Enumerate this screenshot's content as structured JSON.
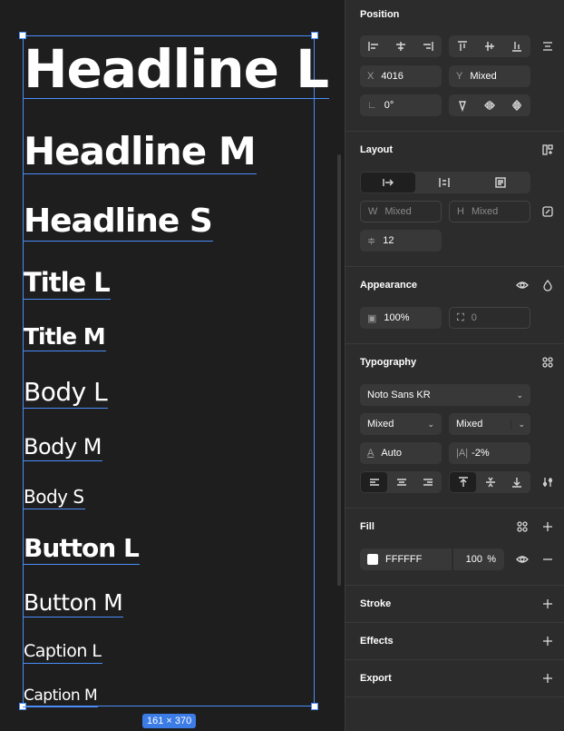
{
  "canvas": {
    "size_badge": "161 × 370",
    "samples": [
      {
        "label": "Headline L"
      },
      {
        "label": "Headline M"
      },
      {
        "label": "Headline S"
      },
      {
        "label": "Title L"
      },
      {
        "label": "Title M"
      },
      {
        "label": "Body L"
      },
      {
        "label": "Body M"
      },
      {
        "label": "Body S"
      },
      {
        "label": "Button L"
      },
      {
        "label": "Button M"
      },
      {
        "label": "Caption L"
      },
      {
        "label": "Caption M"
      }
    ]
  },
  "position": {
    "title": "Position",
    "x_label": "X",
    "x_value": "4016",
    "y_label": "Y",
    "y_value": "Mixed",
    "rotation_value": "0°"
  },
  "layout": {
    "title": "Layout",
    "w_label": "W",
    "w_value": "Mixed",
    "h_label": "H",
    "h_value": "Mixed",
    "gap_value": "12"
  },
  "appearance": {
    "title": "Appearance",
    "opacity_value": "100%",
    "radius_value": "0"
  },
  "typography": {
    "title": "Typography",
    "font_family": "Noto Sans KR",
    "weight": "Mixed",
    "size": "Mixed",
    "line_height": "Auto",
    "letter_spacing": "-2%"
  },
  "fill": {
    "title": "Fill",
    "color_hex": "FFFFFF",
    "opacity": "100",
    "unit": "%"
  },
  "stroke": {
    "title": "Stroke"
  },
  "effects": {
    "title": "Effects"
  },
  "export": {
    "title": "Export"
  }
}
